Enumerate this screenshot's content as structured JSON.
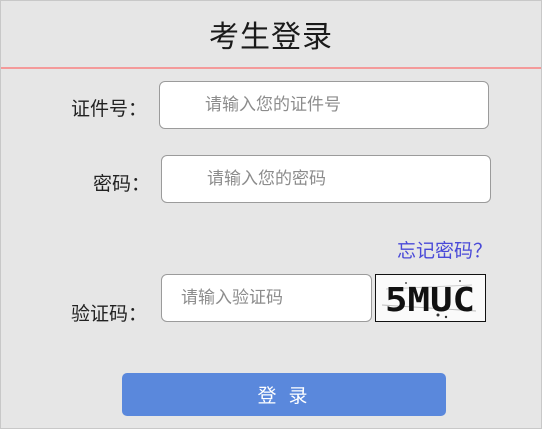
{
  "title": "考生登录",
  "form": {
    "id_label": "证件号：",
    "id_placeholder": "请输入您的证件号",
    "password_label": "密码：",
    "password_placeholder": "请输入您的密码",
    "forgot_link": "忘记密码？",
    "captcha_label": "验证码：",
    "captcha_placeholder": "请输入验证码",
    "captcha_text": "5MUC",
    "submit_label": "登 录"
  },
  "colors": {
    "accent_line": "#f49a9a",
    "link": "#4a4ad8",
    "button": "#5a88dc",
    "background": "#e6e6e6"
  }
}
